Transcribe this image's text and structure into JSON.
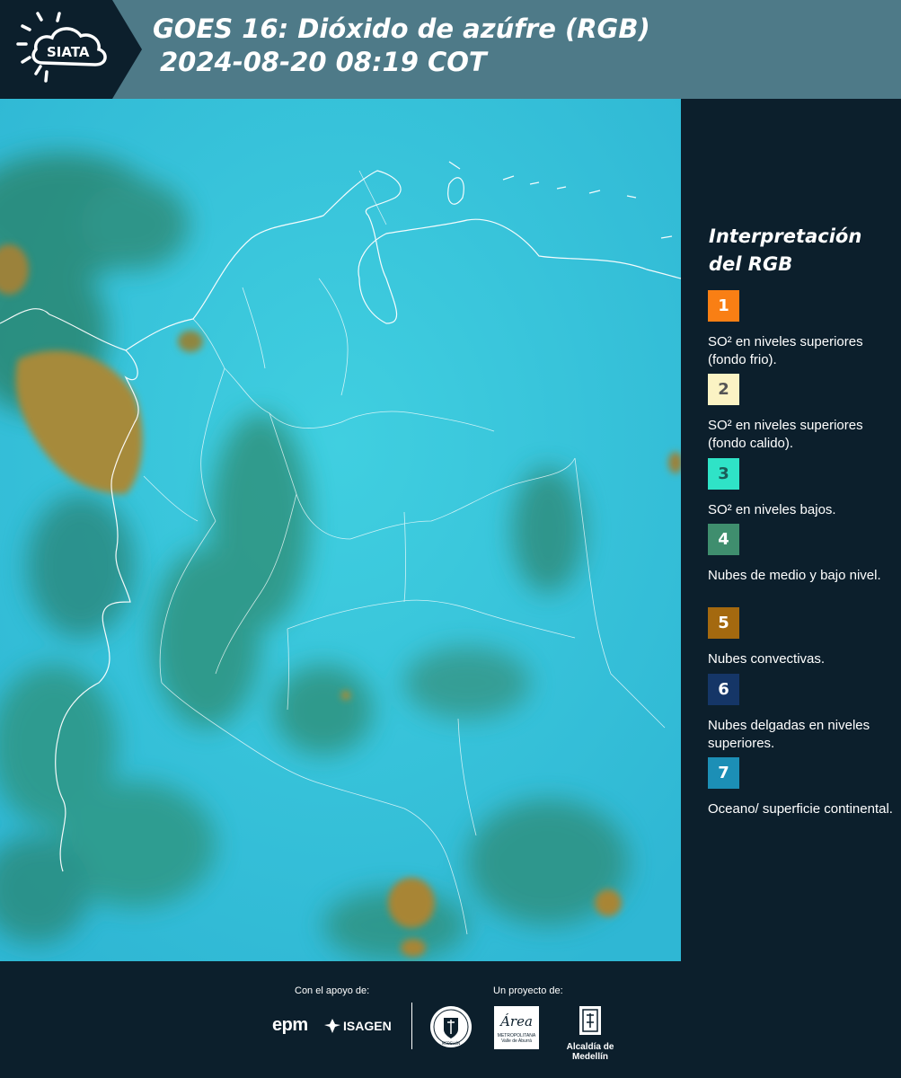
{
  "header": {
    "logo_text": "SIATA",
    "title_line1": "GOES 16: Dióxido de azúfre (RGB)",
    "title_line2": "2024-08-20 08:19 COT"
  },
  "legend": {
    "title": "Interpretación del RGB",
    "items": [
      {
        "number": "1",
        "text": "SO² en niveles superiores (fondo frio).",
        "color": "#f97f14",
        "num_color": "#ffffff"
      },
      {
        "number": "2",
        "text": "SO² en niveles superiores (fondo calido).",
        "color": "#fbf3c4",
        "num_color": "#555555"
      },
      {
        "number": "3",
        "text": "SO² en niveles bajos.",
        "color": "#2fe3c7",
        "num_color": "#1b5c58"
      },
      {
        "number": "4",
        "text": "Nubes de medio y bajo nivel.",
        "color": "#3f8e6e",
        "num_color": "#ffffff"
      },
      {
        "number": "5",
        "text": "Nubes convectivas.",
        "color": "#a4690f",
        "num_color": "#ffffff"
      },
      {
        "number": "6",
        "text": "Nubes delgadas en niveles superiores.",
        "color": "#153667",
        "num_color": "#ffffff"
      },
      {
        "number": "7",
        "text": "Oceano/ superficie continental.",
        "color": "#1c8fb6",
        "num_color": "#ffffff"
      }
    ]
  },
  "footer": {
    "support_label": "Con el apoyo de:",
    "project_label": "Un proyecto de:",
    "sponsor_epm": "epm",
    "sponsor_isagen": "ISAGEN",
    "sponsor_area": "Área",
    "sponsor_area_sub": "METROPOLITANA",
    "sponsor_area_sub2": "Valle de Aburrá",
    "sponsor_alcaldia": "Alcaldía de Medellín",
    "seal_text": "MEDELLÍN"
  },
  "colors": {
    "header_bg": "#4e7a88",
    "page_bg": "#0c1f2c",
    "map_base": "#33c3da",
    "cloud_green": "#2f8f78",
    "convective_brown": "#a4813a"
  }
}
